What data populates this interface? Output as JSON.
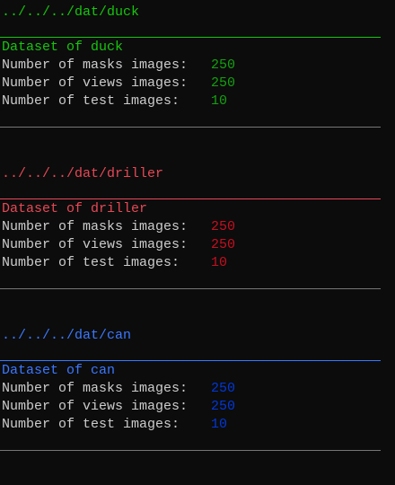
{
  "datasets": [
    {
      "path": "../../../dat/duck",
      "title": "Dataset of duck",
      "color": "#16c60c",
      "value_color": "#13a10e",
      "rows": [
        {
          "label": "Number of masks images:",
          "value": "250"
        },
        {
          "label": "Number of views images:",
          "value": "250"
        },
        {
          "label": "Number of test images:",
          "value": "10"
        }
      ]
    },
    {
      "path": "../../../dat/driller",
      "title": "Dataset of driller",
      "color": "#e74856",
      "value_color": "#c50f1f",
      "rows": [
        {
          "label": "Number of masks images:",
          "value": "250"
        },
        {
          "label": "Number of views images:",
          "value": "250"
        },
        {
          "label": "Number of test images:",
          "value": "10"
        }
      ]
    },
    {
      "path": "../../../dat/can",
      "title": "Dataset of can",
      "color": "#3b78ff",
      "value_color": "#0037da",
      "rows": [
        {
          "label": "Number of masks images:",
          "value": "250"
        },
        {
          "label": "Number of views images:",
          "value": "250"
        },
        {
          "label": "Number of test images:",
          "value": "10"
        }
      ]
    }
  ],
  "separator_color": "#767676"
}
